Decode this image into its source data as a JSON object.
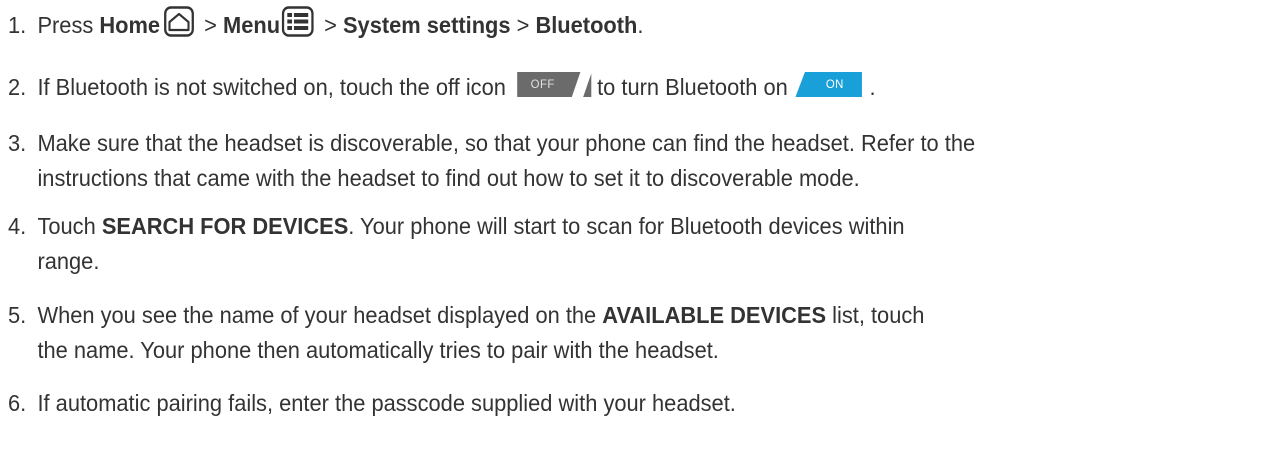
{
  "steps": [
    {
      "num": "1.",
      "pre": "Press ",
      "home": "Home",
      "sep1": " > ",
      "menu": "Menu",
      "sep2": " > ",
      "system_settings": "System settings",
      "sep3": " > ",
      "bluetooth": "Bluetooth",
      "end": ".",
      "home_icon": "home-icon",
      "menu_icon": "menu-icon"
    },
    {
      "num": "2.",
      "text1": "If Bluetooth is not switched on, touch the off icon",
      "off_label": "OFF",
      "text2": "to turn Bluetooth on",
      "on_label": "ON",
      "end": "."
    },
    {
      "num": "3.",
      "line1": "Make sure that the headset is discoverable, so that your phone can find the headset. Refer to the",
      "line2": "instructions that came with the headset to find out how to set it to discoverable mode."
    },
    {
      "num": "4.",
      "pre": "Touch ",
      "search": "SEARCH FOR DEVICES",
      "post": ". Your phone will start to scan for Bluetooth devices within",
      "line2": "range."
    },
    {
      "num": "5.",
      "pre": "When you see the name of your headset displayed on the ",
      "available": "AVAILABLE DEVICES",
      "post": " list, touch",
      "line2": "the name. Your phone then automatically tries to pair with the headset."
    },
    {
      "num": "6.",
      "text": "If automatic pairing fails, enter the passcode supplied with your headset."
    }
  ],
  "colors": {
    "text": "#333333",
    "toggle_off_bg": "#6b6b6b",
    "toggle_on_bg": "#1aa0d8"
  }
}
